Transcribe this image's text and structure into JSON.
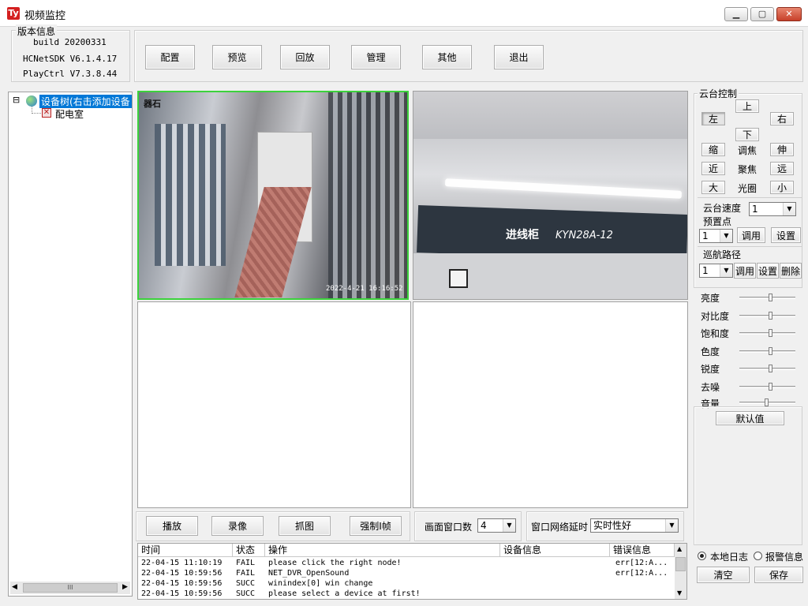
{
  "window": {
    "title": "视频监控",
    "app_icon": "Ty",
    "minimize_icon": "minimize-icon",
    "maximize_icon": "maximize-icon",
    "close_icon": "close-icon"
  },
  "version_box": {
    "title": "版本信息",
    "build": "build 20200331",
    "sdk": "HCNetSDK V6.1.4.17",
    "playctrl": "PlayCtrl V7.3.8.44"
  },
  "toolbar": {
    "config": "配置",
    "preview": "预览",
    "playback": "回放",
    "manage": "管理",
    "other": "其他",
    "exit": "退出"
  },
  "tree": {
    "root_label": "设备树(右击添加设备",
    "child_label": "配电室",
    "expand_symbol": "⊟",
    "scroll_thumb": "III"
  },
  "video": {
    "cam1_overlay": "2022-4-21 16:16:52",
    "cam1_logo": "器石",
    "cam2_sign": "进线柜",
    "cam2_model": "KYN28A-12"
  },
  "bottom_controls": {
    "play": "播放",
    "record": "录像",
    "capture": "抓图",
    "force_iframe": "强制I帧",
    "window_count_label": "画面窗口数",
    "window_count_value": "4",
    "net_delay_label": "窗口网络延时",
    "net_delay_value": "实时性好"
  },
  "log_table": {
    "columns": [
      "时间",
      "状态",
      "操作",
      "设备信息",
      "错误信息"
    ],
    "rows": [
      [
        "22-04-15 11:10:19",
        "FAIL",
        "please click the right node!",
        "",
        "err[12:A..."
      ],
      [
        "22-04-15 10:59:56",
        "FAIL",
        "NET_DVR_OpenSound",
        "",
        "err[12:A..."
      ],
      [
        "22-04-15 10:59:56",
        "SUCC",
        "winindex[0] win change",
        "",
        ""
      ],
      [
        "22-04-15 10:59:56",
        "SUCC",
        "please select a device at first!",
        "",
        ""
      ]
    ]
  },
  "ptz": {
    "title": "云台控制",
    "up": "上",
    "down": "下",
    "left": "左",
    "right": "右",
    "zoom_in": "缩",
    "zoom_label": "调焦",
    "zoom_out": "伸",
    "near": "近",
    "focus_label": "聚焦",
    "far": "远",
    "big": "大",
    "iris_label": "光圈",
    "small": "小",
    "speed_label": "云台速度",
    "speed_value": "1",
    "preset_label": "预置点",
    "preset_value": "1",
    "call": "调用",
    "set": "设置",
    "cruise_label": "巡航路径",
    "cruise_value": "1",
    "cruise_call": "调用",
    "cruise_set": "设置",
    "cruise_delete": "删除"
  },
  "image_adjust": {
    "brightness": "亮度",
    "contrast": "对比度",
    "saturation": "饱和度",
    "hue": "色度",
    "sharpness": "锐度",
    "denoise": "去噪",
    "volume": "音量",
    "default_button": "默认值",
    "levels": {
      "brightness": 0.55,
      "contrast": 0.55,
      "saturation": 0.55,
      "hue": 0.55,
      "sharpness": 0.55,
      "denoise": 0.55,
      "volume": 0.45
    }
  },
  "log_options": {
    "local_log": "本地日志",
    "alarm_info": "报警信息",
    "clear": "清空",
    "save": "保存",
    "selected": "local_log"
  },
  "colors": {
    "active_pane": "#3cd23c",
    "tree_selected": "#0078d7",
    "close_button": "#c7402a"
  }
}
